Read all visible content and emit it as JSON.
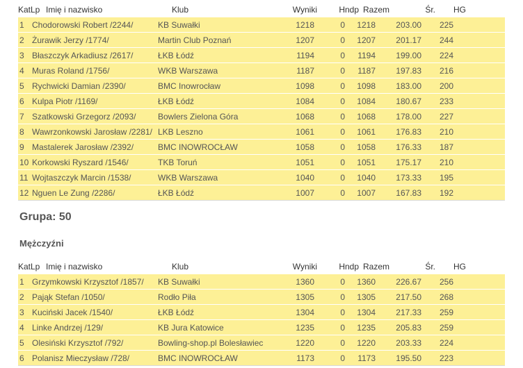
{
  "table1": {
    "headers": {
      "katlp": "KatLp",
      "name": "Imię i nazwisko",
      "club": "Klub",
      "wyniki": "Wyniki",
      "hndp": "Hndp",
      "razem": "Razem",
      "sr": "Śr.",
      "hg": "HG"
    },
    "rows": [
      {
        "lp": "1",
        "name": "Chodorowski Robert /2244/",
        "club": "KB Suwałki",
        "wyniki": "1218",
        "hndp": "0",
        "razem": "1218",
        "sr": "203.00",
        "hg": "225"
      },
      {
        "lp": "2",
        "name": "Żurawik Jerzy /1774/",
        "club": "Martin Club Poznań",
        "wyniki": "1207",
        "hndp": "0",
        "razem": "1207",
        "sr": "201.17",
        "hg": "244"
      },
      {
        "lp": "3",
        "name": "Błaszczyk Arkadiusz /2617/",
        "club": "ŁKB Łódź",
        "wyniki": "1194",
        "hndp": "0",
        "razem": "1194",
        "sr": "199.00",
        "hg": "224"
      },
      {
        "lp": "4",
        "name": "Muras Roland /1756/",
        "club": "WKB Warszawa",
        "wyniki": "1187",
        "hndp": "0",
        "razem": "1187",
        "sr": "197.83",
        "hg": "216"
      },
      {
        "lp": "5",
        "name": "Rychwicki Damian /2390/",
        "club": "BMC Inowrocław",
        "wyniki": "1098",
        "hndp": "0",
        "razem": "1098",
        "sr": "183.00",
        "hg": "200"
      },
      {
        "lp": "6",
        "name": "Kulpa Piotr /1169/",
        "club": "ŁKB Łódź",
        "wyniki": "1084",
        "hndp": "0",
        "razem": "1084",
        "sr": "180.67",
        "hg": "233"
      },
      {
        "lp": "7",
        "name": "Szatkowski Grzegorz /2093/",
        "club": "Bowlers Zielona Góra",
        "wyniki": "1068",
        "hndp": "0",
        "razem": "1068",
        "sr": "178.00",
        "hg": "227"
      },
      {
        "lp": "8",
        "name": "Wawrzonkowski Jarosław /2281/",
        "club": "LKB Leszno",
        "wyniki": "1061",
        "hndp": "0",
        "razem": "1061",
        "sr": "176.83",
        "hg": "210"
      },
      {
        "lp": "9",
        "name": "Mastalerek Jarosław /2392/",
        "club": "BMC INOWROCŁAW",
        "wyniki": "1058",
        "hndp": "0",
        "razem": "1058",
        "sr": "176.33",
        "hg": "187"
      },
      {
        "lp": "10",
        "name": "Korkowski Ryszard /1546/",
        "club": "TKB Toruń",
        "wyniki": "1051",
        "hndp": "0",
        "razem": "1051",
        "sr": "175.17",
        "hg": "210"
      },
      {
        "lp": "11",
        "name": "Wojtaszczyk Marcin /1538/",
        "club": "WKB Warszawa",
        "wyniki": "1040",
        "hndp": "0",
        "razem": "1040",
        "sr": "173.33",
        "hg": "195"
      },
      {
        "lp": "12",
        "name": "Nguen Le Zung /2286/",
        "club": "ŁKB Łódź",
        "wyniki": "1007",
        "hndp": "0",
        "razem": "1007",
        "sr": "167.83",
        "hg": "192"
      }
    ]
  },
  "group": {
    "title": "Grupa: 50",
    "subtitle": "Mężczyźni"
  },
  "table2": {
    "headers": {
      "katlp": "KatLp",
      "name": "Imię i nazwisko",
      "club": "Klub",
      "wyniki": "Wyniki",
      "hndp": "Hndp",
      "razem": "Razem",
      "sr": "Śr.",
      "hg": "HG"
    },
    "rows": [
      {
        "lp": "1",
        "name": "Grzymkowski Krzysztof /1857/",
        "club": "KB Suwałki",
        "wyniki": "1360",
        "hndp": "0",
        "razem": "1360",
        "sr": "226.67",
        "hg": "256"
      },
      {
        "lp": "2",
        "name": "Pająk Stefan /1050/",
        "club": "Rodło Piła",
        "wyniki": "1305",
        "hndp": "0",
        "razem": "1305",
        "sr": "217.50",
        "hg": "268"
      },
      {
        "lp": "3",
        "name": "Kuciński Jacek /1540/",
        "club": "ŁKB Łódź",
        "wyniki": "1304",
        "hndp": "0",
        "razem": "1304",
        "sr": "217.33",
        "hg": "259"
      },
      {
        "lp": "4",
        "name": "Linke Andrzej /129/",
        "club": "KB Jura Katowice",
        "wyniki": "1235",
        "hndp": "0",
        "razem": "1235",
        "sr": "205.83",
        "hg": "259"
      },
      {
        "lp": "5",
        "name": "Olesiński Krzysztof /792/",
        "club": "Bowling-shop.pl Bolesławiec",
        "wyniki": "1220",
        "hndp": "0",
        "razem": "1220",
        "sr": "203.33",
        "hg": "224"
      },
      {
        "lp": "6",
        "name": "Polanisz Mieczysław /728/",
        "club": "BMC INOWROCŁAW",
        "wyniki": "1173",
        "hndp": "0",
        "razem": "1173",
        "sr": "195.50",
        "hg": "223"
      }
    ]
  }
}
